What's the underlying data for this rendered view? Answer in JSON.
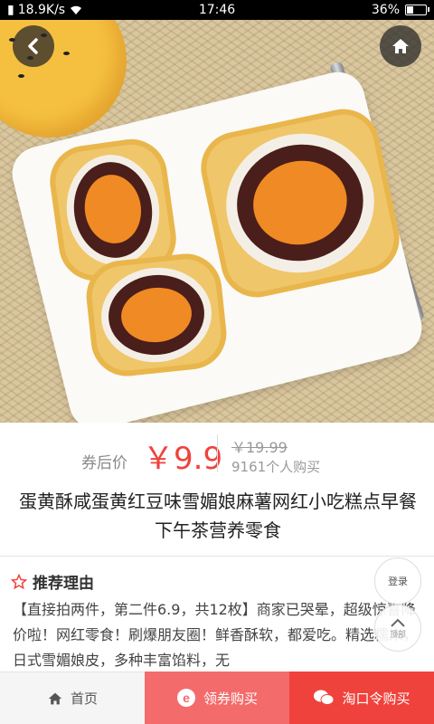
{
  "status_bar": {
    "network_speed": "18.9K/s",
    "time": "17:46",
    "battery": "36%",
    "battery_level": 0.36
  },
  "nav": {
    "back_icon": "chevron-left-icon",
    "home_icon": "home-icon"
  },
  "price": {
    "after_coupon_label": "券后价",
    "current": "￥9.9",
    "original": "￥19.99",
    "sold": "9161个人购买"
  },
  "product": {
    "title": "蛋黄酥咸蛋黄红豆味雪媚娘麻薯网红小吃糕点早餐下午茶营养零食"
  },
  "recommend": {
    "icon": "star-outline-icon",
    "heading": "推荐理由",
    "text": "【直接拍两件，第二件6.9，共12枚】商家已哭晕，超级惊喜降价啦！网红零食！刷爆朋友圈！鲜香酥软，都爱吃。精选糯米，日式雪媚娘皮，多种丰富馅料，无"
  },
  "float": {
    "login_label": "登录",
    "top_label": "顶部"
  },
  "bottom_bar": {
    "home": "首页",
    "coupon": "领券购买",
    "taokouling": "淘口令购买"
  },
  "colors": {
    "accent_red": "#f0423c",
    "coupon_red": "#f46b6b"
  }
}
